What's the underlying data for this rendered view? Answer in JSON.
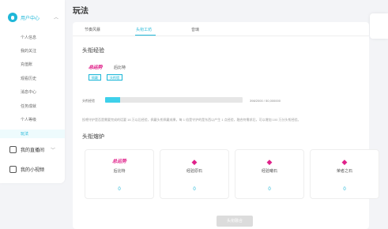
{
  "page_title": "玩法",
  "sidebar": {
    "header_label": "用户中心",
    "items": [
      {
        "label": "个人信息"
      },
      {
        "label": "我的关注"
      },
      {
        "label": "充值账"
      },
      {
        "label": "观看历史"
      },
      {
        "label": "消息中心"
      },
      {
        "label": "任务成就"
      },
      {
        "label": "个人等级"
      },
      {
        "label": "玩法"
      }
    ],
    "groups": [
      {
        "label": "我的直播间"
      },
      {
        "label": "我的小视频"
      }
    ]
  },
  "tabs": [
    {
      "label": "节奏风暴"
    },
    {
      "label": "头衔工坊"
    },
    {
      "label": "音璃"
    }
  ],
  "fan_exp": {
    "title": "头衔经验",
    "logo_text": "总运势",
    "name": "后比特",
    "badges": [
      "佩戴",
      "头衔墙"
    ],
    "label": "头衔经验",
    "progress": 0.11,
    "progress_text": "398/2000 / 50,000000",
    "note": "投喂守护是否是需要完成的话要 16 万以后经验，佩戴头衔佩戴成果，每 1 倍是守护的是东西以产生 1 点经验，融合符需求后，可以增加 100 万分头衔经验。"
  },
  "furnace": {
    "title": "头衔熔炉",
    "cards": [
      {
        "logo": "总运势",
        "name": "后比特",
        "value": "0"
      },
      {
        "icon": "gem-icon",
        "name": "经验原石",
        "value": "0"
      },
      {
        "icon": "gem-icon",
        "name": "经验曦石",
        "value": "0"
      },
      {
        "icon": "gem-icon",
        "name": "荣者之石",
        "value": "0"
      }
    ],
    "fuse_button": "头衔融合"
  },
  "colors": {
    "accent": "#1fb7d8",
    "brand_pink": "#e0218a",
    "progress": "#3ed0ea"
  }
}
